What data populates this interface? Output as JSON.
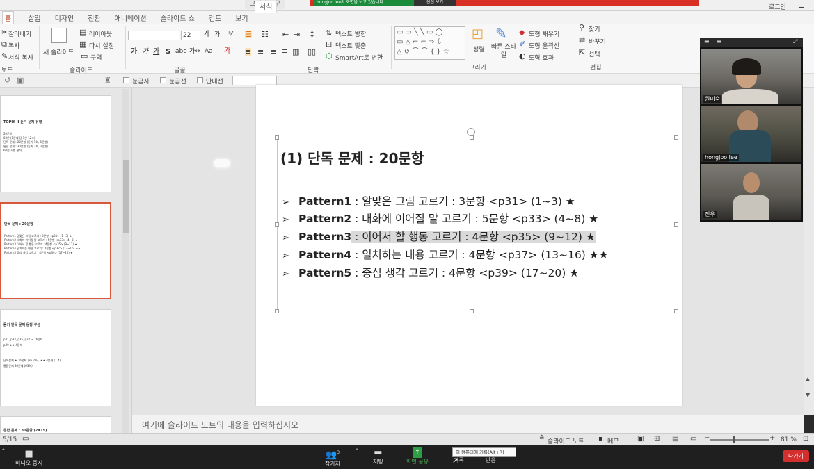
{
  "topbar": {
    "draw_tool_tab": "그리기 도구",
    "share_banner": "hongjoo lee의 화면을 보고 있습니다",
    "stop_share": "옵션 보기",
    "login": "로그인"
  },
  "tabs": [
    "홈",
    "삽입",
    "디자인",
    "전환",
    "애니메이션",
    "슬라이드 쇼",
    "검토",
    "보기"
  ],
  "format_tab": "서식",
  "ribbon": {
    "clipboard": {
      "cut": "잘라내기",
      "copy": "복사",
      "format_copy": "서식 복사",
      "label": "보드"
    },
    "slides": {
      "new_slide": "새 슬라이드",
      "layout": "레이아웃",
      "reset": "다시 설정",
      "section": "구역",
      "label": "슬라이드"
    },
    "font": {
      "size": "22",
      "label": "글꼴"
    },
    "paragraph": {
      "text_direction": "텍스트 방향",
      "text_align": "텍스트 맞춤",
      "smartart": "SmartArt로 변환",
      "label": "단락"
    },
    "drawing": {
      "arrange": "정렬",
      "quick_styles": "빠른 스타일",
      "shape_fill": "도형 채우기",
      "shape_outline": "도형 윤곽선",
      "shape_effects": "도형 효과",
      "label": "그리기"
    },
    "editing": {
      "find": "찾기",
      "replace": "바꾸기",
      "select": "선택",
      "label": "편집"
    }
  },
  "quickbar": {
    "ruler": "눈금자",
    "gridlines": "눈금선",
    "guides": "안내선"
  },
  "thumbnails": [
    {
      "title": "TOPIK II 듣기 문제 유형",
      "lines": [
        "20문항",
        "60문 (1문제 당 1분 12초)",
        "단독 문제 : 20문항 (듣기 1회, 1문항)",
        "통합 문제 : 30문항 (듣기 2회, 2문항)",
        "60문 시험 분석"
      ]
    },
    {
      "title": "단독 문제 : 20문항",
      "lines": [
        "Pattern1  알맞은 그림 고르기 : 3문항 <p31> (1~3) ★",
        "Pattern2  대화에 이어질 말 고르기 : 5문항 <p33> (4~8) ★",
        "Pattern3  이어서 할 행동 고르기 : 4문항 <p35> (9~12) ★",
        "Pattern4  일치하는 내용 고르기 : 4문항 <p37> (13~16) ★★",
        "Pattern5  중심 생각 고르기 : 4문항 <p39> (17~20) ★"
      ]
    },
    {
      "title": "듣기 단독 문제 문항 구성",
      "lines": [
        "p31, p33, p35, p37 → 16문제",
        "p39 ★★ 4문제",
        "",
        "단독문제  ★ 16문제 (36.7%), ★★ 4문제 (1.4)",
        "통합문제  30문제 (63%)"
      ]
    },
    {
      "title": "통합 문제 : 30문항 (2X15)",
      "lines": []
    }
  ],
  "slide": {
    "title": "(1) 단독 문제 : 20문항",
    "patterns": [
      {
        "name": "Pattern1",
        "desc": " : 알맞은 그림 고르기 : 3문항 <p31> (1~3) ★"
      },
      {
        "name": "Pattern2",
        "desc": " : 대화에 이어질 말 고르기 : 5문항 <p33> (4~8) ★"
      },
      {
        "name": "Pattern3",
        "desc": " : 이어서 할 행동 고르기 : 4문항 <p35> (9~12) ★"
      },
      {
        "name": "Pattern4",
        "desc": " : 일치하는 내용 고르기 : 4문항 <p37> (13~16) ★★"
      },
      {
        "name": "Pattern5",
        "desc": " : 중심 생각 고르기 : 4문항 <p39> (17~20) ★"
      }
    ]
  },
  "notes_placeholder": "여기에 슬라이드 노트의 내용을 입력하십시오",
  "status": {
    "slide_num": "5/15",
    "notes": "슬라이드 노트",
    "comments": "메모",
    "zoom": "81 %"
  },
  "zoom_bar": {
    "video_stop": "비디오 중지",
    "participants": "참가자",
    "participant_count": "3",
    "chat": "채팅",
    "share": "화면 공유",
    "record": "기록",
    "reactions": "반응",
    "record_tooltip": "이 컴퓨터에 기록(Alt+R)",
    "leave": "나가기"
  },
  "video": [
    {
      "name": "원미숙"
    },
    {
      "name": "hongjoo lee"
    },
    {
      "name": "진우"
    }
  ]
}
